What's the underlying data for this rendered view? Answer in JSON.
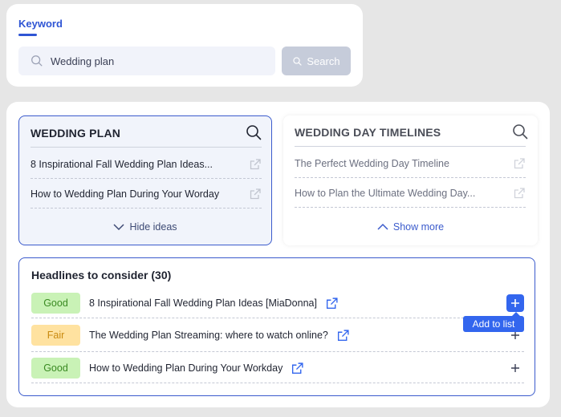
{
  "keyword": {
    "tab_label": "Keyword",
    "search_value": "Wedding plan",
    "search_button": "Search"
  },
  "panels": [
    {
      "title": "WEDDING PLAN",
      "items": [
        "8 Inspirational Fall Wedding Plan Ideas...",
        "How to Wedding Plan During Your Worday"
      ],
      "toggle_label": "Hide ideas"
    },
    {
      "title": "WEDDING DAY TIMELINES",
      "items": [
        "The Perfect Wedding Day Timeline",
        "How to Plan the Ultimate Wedding Day..."
      ],
      "toggle_label": "Show more"
    }
  ],
  "headlines": {
    "title": "Headlines to consider (30)",
    "rows": [
      {
        "badge": "Good",
        "text": "8 Inspirational Fall Wedding Plan Ideas [MiaDonna]"
      },
      {
        "badge": "Fair",
        "text": "The Wedding Plan Streaming: where to watch online?"
      },
      {
        "badge": "Good",
        "text": "How to Wedding Plan During Your Workday"
      }
    ],
    "tooltip": "Add to list"
  },
  "colors": {
    "accent": "#3366ee",
    "good_bg": "#c9f2b6",
    "fair_bg": "#ffe2a0"
  }
}
